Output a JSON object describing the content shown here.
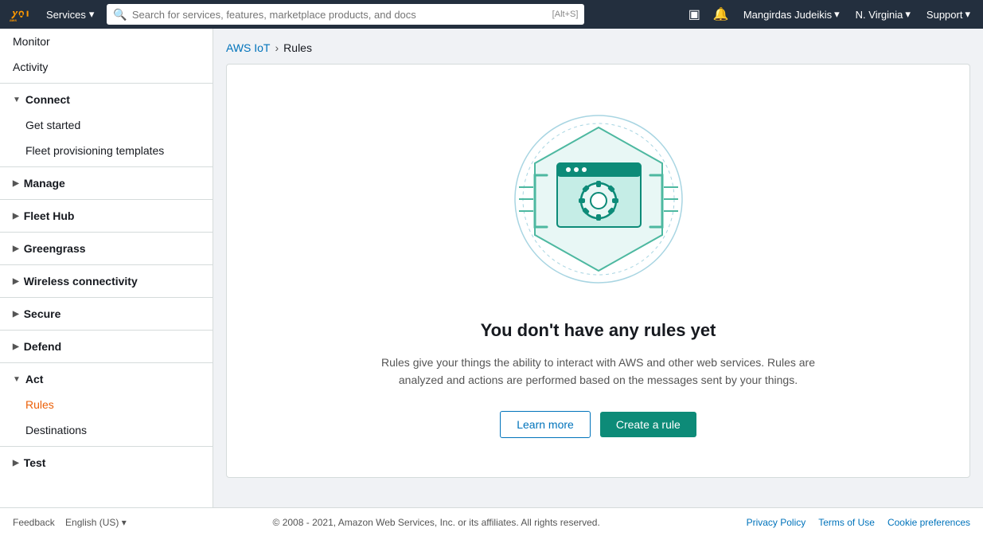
{
  "topnav": {
    "services_label": "Services",
    "search_placeholder": "Search for services, features, marketplace products, and docs",
    "search_shortcut": "[Alt+S]",
    "terminal_icon": "▣",
    "bell_icon": "🔔",
    "user_name": "Mangirdas Judeikis",
    "region": "N. Virginia",
    "support": "Support"
  },
  "sidebar": {
    "monitor_label": "Monitor",
    "activity_label": "Activity",
    "connect_section": "Connect",
    "get_started_label": "Get started",
    "fleet_templates_label": "Fleet provisioning templates",
    "manage_section": "Manage",
    "fleet_hub_section": "Fleet Hub",
    "greengrass_section": "Greengrass",
    "wireless_label": "Wireless connectivity",
    "secure_section": "Secure",
    "defend_section": "Defend",
    "act_section": "Act",
    "rules_label": "Rules",
    "destinations_label": "Destinations",
    "test_section": "Test"
  },
  "breadcrumb": {
    "aws_iot_label": "AWS IoT",
    "separator": "›",
    "current": "Rules"
  },
  "main": {
    "empty_title": "You don't have any rules yet",
    "empty_desc": "Rules give your things the ability to interact with AWS and other web services. Rules are analyzed and actions are performed based on the messages sent by your things.",
    "learn_more_label": "Learn more",
    "create_rule_label": "Create a rule"
  },
  "footer": {
    "feedback_label": "Feedback",
    "language_label": "English (US)",
    "copyright": "© 2008 - 2021, Amazon Web Services, Inc. or its affiliates. All rights reserved.",
    "privacy_label": "Privacy Policy",
    "terms_label": "Terms of Use",
    "cookie_label": "Cookie preferences"
  },
  "colors": {
    "teal": "#0d8b78",
    "teal_light": "#1abc9c",
    "teal_circle": "#4db8a0",
    "blue_link": "#0073bb",
    "orange_active": "#eb5f07"
  }
}
